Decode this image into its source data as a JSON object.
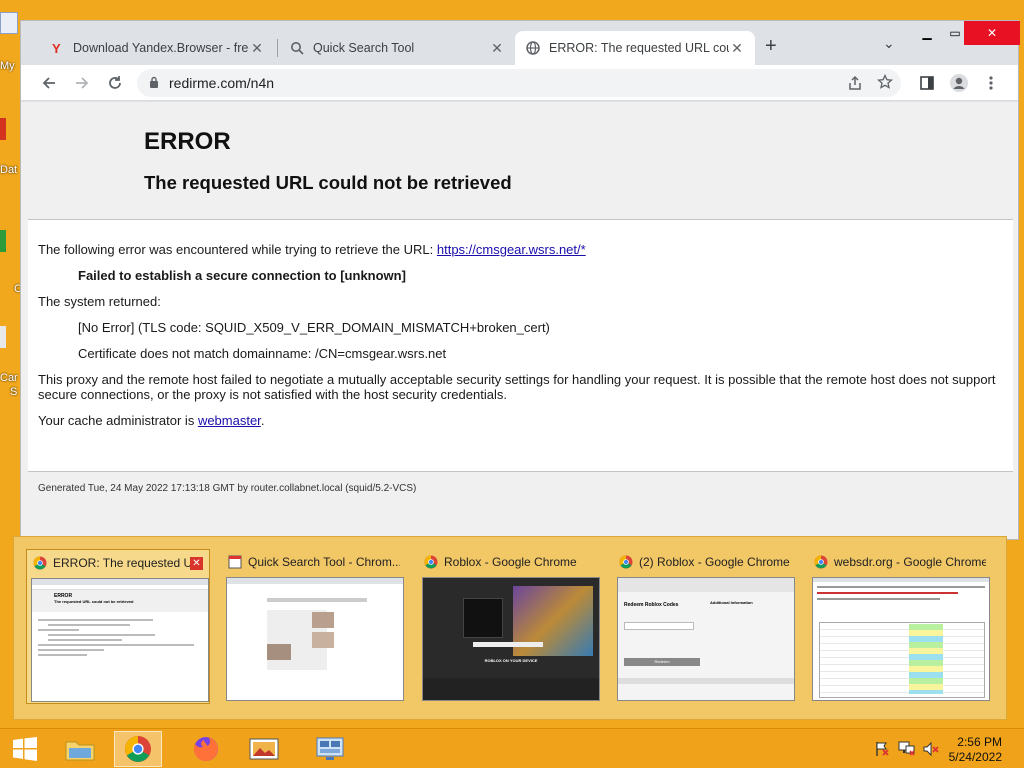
{
  "desktop": {
    "labels": [
      "My",
      "Dat",
      "C",
      "Car",
      "S"
    ]
  },
  "browser": {
    "tabs": [
      {
        "title": "Download Yandex.Browser - free",
        "icon": "yandex-icon"
      },
      {
        "title": "Quick Search Tool",
        "icon": "search-icon"
      },
      {
        "title": "ERROR: The requested URL could",
        "icon": "globe-icon",
        "active": true
      }
    ],
    "url": "redirme.com/n4n"
  },
  "page": {
    "heading": "ERROR",
    "subheading": "The requested URL could not be retrieved",
    "intro": "The following error was encountered while trying to retrieve the URL: ",
    "intro_link": "https://cmsgear.wsrs.net/*",
    "failure": "Failed to establish a secure connection to [unknown]",
    "system_returned": "The system returned:",
    "system_error": "[No Error] (TLS code: SQUID_X509_V_ERR_DOMAIN_MISMATCH+broken_cert)",
    "cert_msg": "Certificate does not match domainname: /CN=cmsgear.wsrs.net",
    "explanation": "This proxy and the remote host failed to negotiate a mutually acceptable security settings for handling your request. It is possible that the remote host does not support secure connections, or the proxy is not satisfied with the host security credentials.",
    "admin_prefix": "Your cache administrator is ",
    "admin_link": "webmaster",
    "admin_suffix": ".",
    "generated": "Generated Tue, 24 May 2022 17:13:18 GMT by router.collabnet.local (squid/5.2-VCS)"
  },
  "thumbnails": [
    {
      "title": "ERROR: The requested U...",
      "active": true
    },
    {
      "title": "Quick Search Tool - Chrom..."
    },
    {
      "title": "Roblox - Google Chrome"
    },
    {
      "title": "(2) Roblox - Google Chrome"
    },
    {
      "title": "websdr.org - Google Chrome"
    }
  ],
  "thumb_preview": {
    "error_heading": "ERROR",
    "error_sub": "The requested URL could not be retrieved",
    "roblox_bar": "ROBLOX ON YOUR DEVICE",
    "redeem_title": "Redeem Roblox Codes",
    "redeem_side": "Additional Information",
    "redeem_button": "Redeem"
  },
  "taskbar": {
    "time": "2:56 PM",
    "date": "5/24/2022"
  },
  "colors": {
    "desktop": "#f2a81c",
    "taskbar": "#f0a31a",
    "link": "#1a0dab"
  }
}
